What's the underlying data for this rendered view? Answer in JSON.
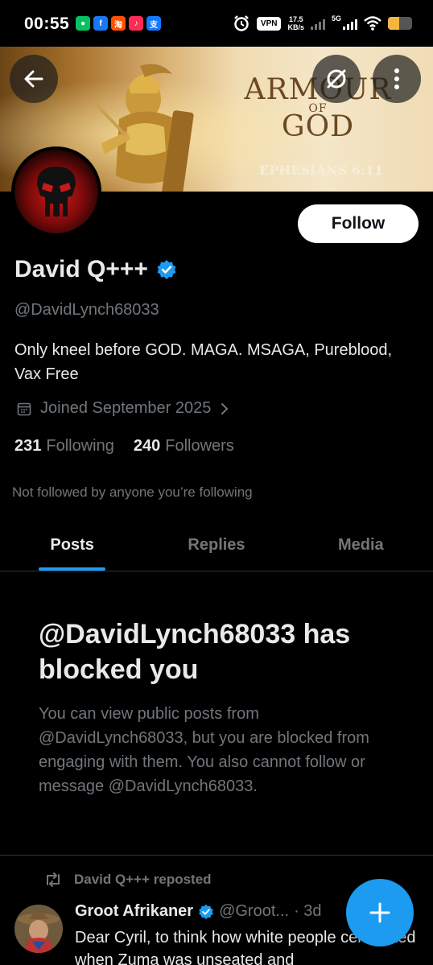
{
  "status_bar": {
    "time": "00:55",
    "vpn": "VPN",
    "speed_value": "17.5",
    "speed_unit": "KB/s",
    "network": "5G",
    "battery_level": 0.45,
    "battery_color": "#f4b63f"
  },
  "banner": {
    "title_line1": "ARMOUR",
    "title_line2": "OF",
    "title_line3": "GOD",
    "verse": "EPHESIANS 6:11"
  },
  "profile": {
    "display_name": "David Q+++",
    "verified": true,
    "handle": "@DavidLynch68033",
    "bio": "Only kneel before GOD. MAGA. MSAGA, Pureblood, Vax Free",
    "joined": "Joined September 2025",
    "following_count": "231",
    "following_label": "Following",
    "followers_count": "240",
    "followers_label": "Followers",
    "not_followed": "Not followed by anyone you’re following",
    "follow_label": "Follow"
  },
  "tabs": [
    {
      "label": "Posts",
      "active": true
    },
    {
      "label": "Replies",
      "active": false
    },
    {
      "label": "Media",
      "active": false
    }
  ],
  "blocked": {
    "title": "@DavidLynch68033 has blocked you",
    "body": "You can view public posts from @DavidLynch68033, but you are blocked from engaging with them. You also cannot follow or message @DavidLynch68033."
  },
  "post": {
    "reposted_by": "David Q+++ reposted",
    "author_name": "Groot Afrikaner",
    "author_handle": "@Groot...",
    "time": "· 3d",
    "text": "Dear Cyril, to think how white people celebrated when Zuma was unseated and"
  },
  "colors": {
    "accent": "#1d9bf0",
    "background": "#000000",
    "secondary_text": "#71767b"
  }
}
